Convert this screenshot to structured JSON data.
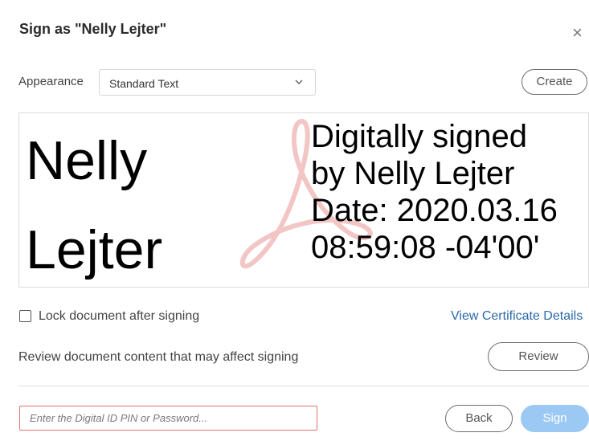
{
  "dialog": {
    "title": "Sign as \"Nelly Lejter\"",
    "close_icon": "close-icon"
  },
  "appearance": {
    "label": "Appearance",
    "selected": "Standard Text",
    "create_label": "Create"
  },
  "preview": {
    "name_line1": "Nelly",
    "name_line2": "Lejter",
    "details": [
      "Digitally signed",
      "by Nelly Lejter",
      "Date: 2020.03.16",
      "08:59:08 -04'00'"
    ],
    "watermark_icon": "adobe-acrobat-logo-icon"
  },
  "options": {
    "lock_label": "Lock document after signing",
    "lock_checked": false,
    "view_cert_label": "View Certificate Details"
  },
  "review": {
    "text": "Review document content that may affect signing",
    "button_label": "Review"
  },
  "footer": {
    "pin_placeholder": "Enter the Digital ID PIN or Password...",
    "pin_value": "",
    "back_label": "Back",
    "sign_label": "Sign"
  },
  "colors": {
    "link": "#2b6aa8",
    "sign_button_disabled": "#9cc9f3",
    "input_error_border": "#e07070",
    "watermark": "#f3c6c6"
  }
}
